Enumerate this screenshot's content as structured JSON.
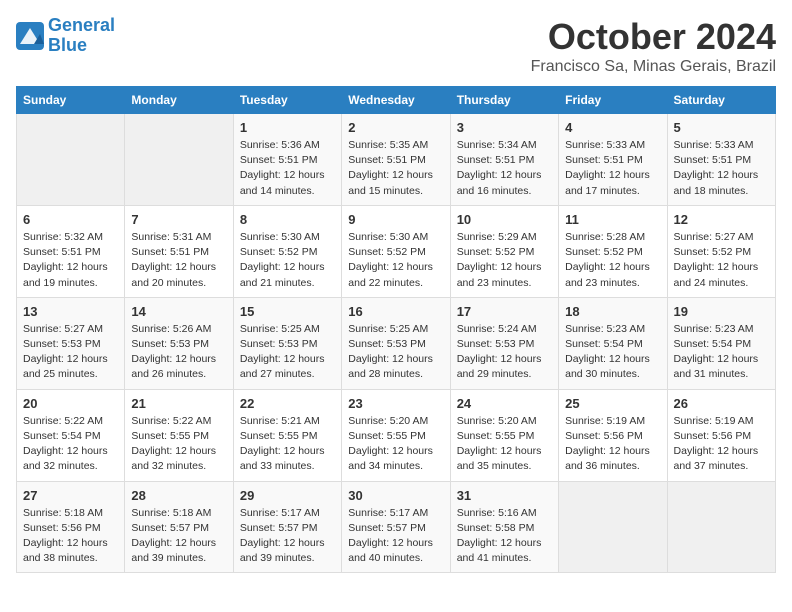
{
  "header": {
    "logo_line1": "General",
    "logo_line2": "Blue",
    "month": "October 2024",
    "location": "Francisco Sa, Minas Gerais, Brazil"
  },
  "weekdays": [
    "Sunday",
    "Monday",
    "Tuesday",
    "Wednesday",
    "Thursday",
    "Friday",
    "Saturday"
  ],
  "weeks": [
    [
      {
        "day": "",
        "sunrise": "",
        "sunset": "",
        "daylight": "",
        "empty": true
      },
      {
        "day": "",
        "sunrise": "",
        "sunset": "",
        "daylight": "",
        "empty": true
      },
      {
        "day": "1",
        "sunrise": "Sunrise: 5:36 AM",
        "sunset": "Sunset: 5:51 PM",
        "daylight": "Daylight: 12 hours and 14 minutes.",
        "empty": false
      },
      {
        "day": "2",
        "sunrise": "Sunrise: 5:35 AM",
        "sunset": "Sunset: 5:51 PM",
        "daylight": "Daylight: 12 hours and 15 minutes.",
        "empty": false
      },
      {
        "day": "3",
        "sunrise": "Sunrise: 5:34 AM",
        "sunset": "Sunset: 5:51 PM",
        "daylight": "Daylight: 12 hours and 16 minutes.",
        "empty": false
      },
      {
        "day": "4",
        "sunrise": "Sunrise: 5:33 AM",
        "sunset": "Sunset: 5:51 PM",
        "daylight": "Daylight: 12 hours and 17 minutes.",
        "empty": false
      },
      {
        "day": "5",
        "sunrise": "Sunrise: 5:33 AM",
        "sunset": "Sunset: 5:51 PM",
        "daylight": "Daylight: 12 hours and 18 minutes.",
        "empty": false
      }
    ],
    [
      {
        "day": "6",
        "sunrise": "Sunrise: 5:32 AM",
        "sunset": "Sunset: 5:51 PM",
        "daylight": "Daylight: 12 hours and 19 minutes.",
        "empty": false
      },
      {
        "day": "7",
        "sunrise": "Sunrise: 5:31 AM",
        "sunset": "Sunset: 5:51 PM",
        "daylight": "Daylight: 12 hours and 20 minutes.",
        "empty": false
      },
      {
        "day": "8",
        "sunrise": "Sunrise: 5:30 AM",
        "sunset": "Sunset: 5:52 PM",
        "daylight": "Daylight: 12 hours and 21 minutes.",
        "empty": false
      },
      {
        "day": "9",
        "sunrise": "Sunrise: 5:30 AM",
        "sunset": "Sunset: 5:52 PM",
        "daylight": "Daylight: 12 hours and 22 minutes.",
        "empty": false
      },
      {
        "day": "10",
        "sunrise": "Sunrise: 5:29 AM",
        "sunset": "Sunset: 5:52 PM",
        "daylight": "Daylight: 12 hours and 23 minutes.",
        "empty": false
      },
      {
        "day": "11",
        "sunrise": "Sunrise: 5:28 AM",
        "sunset": "Sunset: 5:52 PM",
        "daylight": "Daylight: 12 hours and 23 minutes.",
        "empty": false
      },
      {
        "day": "12",
        "sunrise": "Sunrise: 5:27 AM",
        "sunset": "Sunset: 5:52 PM",
        "daylight": "Daylight: 12 hours and 24 minutes.",
        "empty": false
      }
    ],
    [
      {
        "day": "13",
        "sunrise": "Sunrise: 5:27 AM",
        "sunset": "Sunset: 5:53 PM",
        "daylight": "Daylight: 12 hours and 25 minutes.",
        "empty": false
      },
      {
        "day": "14",
        "sunrise": "Sunrise: 5:26 AM",
        "sunset": "Sunset: 5:53 PM",
        "daylight": "Daylight: 12 hours and 26 minutes.",
        "empty": false
      },
      {
        "day": "15",
        "sunrise": "Sunrise: 5:25 AM",
        "sunset": "Sunset: 5:53 PM",
        "daylight": "Daylight: 12 hours and 27 minutes.",
        "empty": false
      },
      {
        "day": "16",
        "sunrise": "Sunrise: 5:25 AM",
        "sunset": "Sunset: 5:53 PM",
        "daylight": "Daylight: 12 hours and 28 minutes.",
        "empty": false
      },
      {
        "day": "17",
        "sunrise": "Sunrise: 5:24 AM",
        "sunset": "Sunset: 5:53 PM",
        "daylight": "Daylight: 12 hours and 29 minutes.",
        "empty": false
      },
      {
        "day": "18",
        "sunrise": "Sunrise: 5:23 AM",
        "sunset": "Sunset: 5:54 PM",
        "daylight": "Daylight: 12 hours and 30 minutes.",
        "empty": false
      },
      {
        "day": "19",
        "sunrise": "Sunrise: 5:23 AM",
        "sunset": "Sunset: 5:54 PM",
        "daylight": "Daylight: 12 hours and 31 minutes.",
        "empty": false
      }
    ],
    [
      {
        "day": "20",
        "sunrise": "Sunrise: 5:22 AM",
        "sunset": "Sunset: 5:54 PM",
        "daylight": "Daylight: 12 hours and 32 minutes.",
        "empty": false
      },
      {
        "day": "21",
        "sunrise": "Sunrise: 5:22 AM",
        "sunset": "Sunset: 5:55 PM",
        "daylight": "Daylight: 12 hours and 32 minutes.",
        "empty": false
      },
      {
        "day": "22",
        "sunrise": "Sunrise: 5:21 AM",
        "sunset": "Sunset: 5:55 PM",
        "daylight": "Daylight: 12 hours and 33 minutes.",
        "empty": false
      },
      {
        "day": "23",
        "sunrise": "Sunrise: 5:20 AM",
        "sunset": "Sunset: 5:55 PM",
        "daylight": "Daylight: 12 hours and 34 minutes.",
        "empty": false
      },
      {
        "day": "24",
        "sunrise": "Sunrise: 5:20 AM",
        "sunset": "Sunset: 5:55 PM",
        "daylight": "Daylight: 12 hours and 35 minutes.",
        "empty": false
      },
      {
        "day": "25",
        "sunrise": "Sunrise: 5:19 AM",
        "sunset": "Sunset: 5:56 PM",
        "daylight": "Daylight: 12 hours and 36 minutes.",
        "empty": false
      },
      {
        "day": "26",
        "sunrise": "Sunrise: 5:19 AM",
        "sunset": "Sunset: 5:56 PM",
        "daylight": "Daylight: 12 hours and 37 minutes.",
        "empty": false
      }
    ],
    [
      {
        "day": "27",
        "sunrise": "Sunrise: 5:18 AM",
        "sunset": "Sunset: 5:56 PM",
        "daylight": "Daylight: 12 hours and 38 minutes.",
        "empty": false
      },
      {
        "day": "28",
        "sunrise": "Sunrise: 5:18 AM",
        "sunset": "Sunset: 5:57 PM",
        "daylight": "Daylight: 12 hours and 39 minutes.",
        "empty": false
      },
      {
        "day": "29",
        "sunrise": "Sunrise: 5:17 AM",
        "sunset": "Sunset: 5:57 PM",
        "daylight": "Daylight: 12 hours and 39 minutes.",
        "empty": false
      },
      {
        "day": "30",
        "sunrise": "Sunrise: 5:17 AM",
        "sunset": "Sunset: 5:57 PM",
        "daylight": "Daylight: 12 hours and 40 minutes.",
        "empty": false
      },
      {
        "day": "31",
        "sunrise": "Sunrise: 5:16 AM",
        "sunset": "Sunset: 5:58 PM",
        "daylight": "Daylight: 12 hours and 41 minutes.",
        "empty": false
      },
      {
        "day": "",
        "sunrise": "",
        "sunset": "",
        "daylight": "",
        "empty": true
      },
      {
        "day": "",
        "sunrise": "",
        "sunset": "",
        "daylight": "",
        "empty": true
      }
    ]
  ]
}
